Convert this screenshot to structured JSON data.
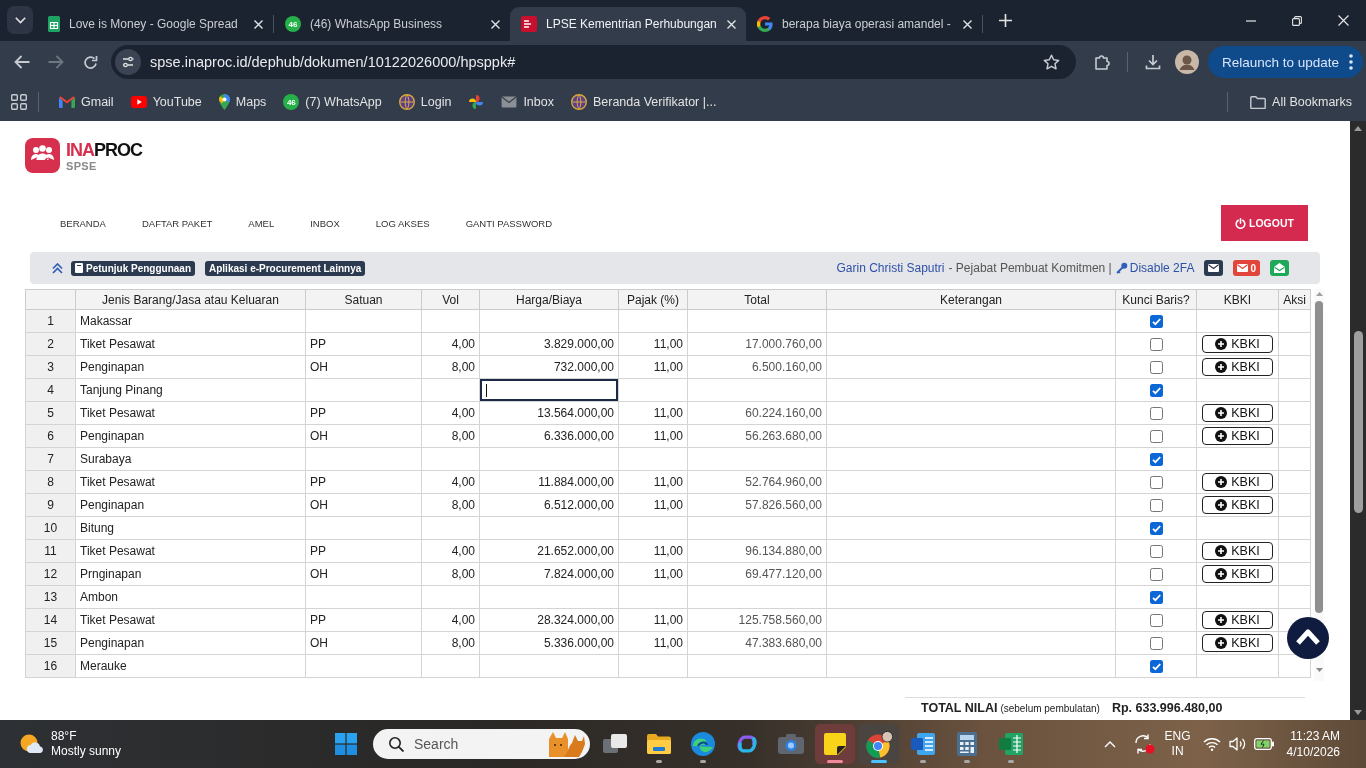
{
  "browser": {
    "tabs": [
      {
        "title": "Love is Money - Google Spread",
        "kind": "sheets",
        "selected": false
      },
      {
        "title": "(46) WhatsApp Business",
        "kind": "chat",
        "badge": "46",
        "selected": false
      },
      {
        "title": "LPSE Kementrian Perhubungan",
        "kind": "logo",
        "selected": true
      },
      {
        "title": "berapa biaya operasi amandel -",
        "kind": "search",
        "selected": false
      }
    ],
    "address": "spse.inaproc.id/dephub/dokumen/10122026000/hpsppk#",
    "relaunch": "Relaunch to update",
    "bookmarks": [
      {
        "label": "Gmail",
        "kind": "gmail"
      },
      {
        "label": "YouTube",
        "kind": "video"
      },
      {
        "label": "Maps",
        "kind": "pin"
      },
      {
        "label": "(7) WhatsApp",
        "kind": "chat",
        "badge": "46"
      },
      {
        "label": "Login",
        "kind": "globe"
      },
      {
        "kind": "photos"
      },
      {
        "label": "Inbox",
        "kind": "mail"
      },
      {
        "label": "Beranda Verifikator |...",
        "kind": "globe"
      }
    ],
    "all_bookmarks": "All Bookmarks"
  },
  "site": {
    "logo": {
      "wordmark_red": "INA",
      "wordmark_dark": "PROC",
      "subtitle": "SPSE"
    },
    "nav": [
      "BERANDA",
      "DAFTAR PAKET",
      "AMEL",
      "INBOX",
      "LOG AKSES",
      "GANTI PASSWORD"
    ],
    "logout": "LOGOUT",
    "info_bar": {
      "links": [
        {
          "label": "Petunjuk Penggunaan",
          "kind": "guide"
        },
        {
          "label": "Aplikasi e-Procurement Lainnya",
          "kind": "apps"
        }
      ],
      "user": "Garin Christi Saputri",
      "role": "- Pejabat Pembuat Komitmen |",
      "disable_2fa": "Disable 2FA",
      "unread_count": "0"
    }
  },
  "table": {
    "columns": [
      "Jenis Barang/Jasa atau Keluaran",
      "Satuan",
      "Vol",
      "Harga/Biaya",
      "Pajak (%)",
      "Total",
      "Keterangan",
      "Kunci Baris?",
      "KBKI",
      "Aksi"
    ],
    "rows": [
      {
        "no": "1",
        "item": "Makassar",
        "locked": true,
        "editing": false
      },
      {
        "no": "2",
        "item": "Tiket Pesawat",
        "unit": "PP",
        "vol": "4,00",
        "price": "3.829.000,00",
        "tax": "11,00",
        "total": "17.000.760,00",
        "locked": false,
        "editing": false,
        "kbki": "KBKI"
      },
      {
        "no": "3",
        "item": "Penginapan",
        "unit": "OH",
        "vol": "8,00",
        "price": "732.000,00",
        "tax": "11,00",
        "total": "6.500.160,00",
        "locked": false,
        "editing": false,
        "kbki": "KBKI"
      },
      {
        "no": "4",
        "item": "Tanjung Pinang",
        "locked": true,
        "editing": true
      },
      {
        "no": "5",
        "item": "Tiket Pesawat",
        "unit": "PP",
        "vol": "4,00",
        "price": "13.564.000,00",
        "tax": "11,00",
        "total": "60.224.160,00",
        "locked": false,
        "editing": false,
        "kbki": "KBKI"
      },
      {
        "no": "6",
        "item": "Penginapan",
        "unit": "OH",
        "vol": "8,00",
        "price": "6.336.000,00",
        "tax": "11,00",
        "total": "56.263.680,00",
        "locked": false,
        "editing": false,
        "kbki": "KBKI"
      },
      {
        "no": "7",
        "item": "Surabaya",
        "locked": true,
        "editing": false
      },
      {
        "no": "8",
        "item": "Tiket Pesawat",
        "unit": "PP",
        "vol": "4,00",
        "price": "11.884.000,00",
        "tax": "11,00",
        "total": "52.764.960,00",
        "locked": false,
        "editing": false,
        "kbki": "KBKI"
      },
      {
        "no": "9",
        "item": "Penginapan",
        "unit": "OH",
        "vol": "8,00",
        "price": "6.512.000,00",
        "tax": "11,00",
        "total": "57.826.560,00",
        "locked": false,
        "editing": false,
        "kbki": "KBKI"
      },
      {
        "no": "10",
        "item": "Bitung",
        "locked": true,
        "editing": false
      },
      {
        "no": "11",
        "item": "Tiket Pesawat",
        "unit": "PP",
        "vol": "4,00",
        "price": "21.652.000,00",
        "tax": "11,00",
        "total": "96.134.880,00",
        "locked": false,
        "editing": false,
        "kbki": "KBKI"
      },
      {
        "no": "12",
        "item": "Prnginapan",
        "unit": "OH",
        "vol": "8,00",
        "price": "7.824.000,00",
        "tax": "11,00",
        "total": "69.477.120,00",
        "locked": false,
        "editing": false,
        "kbki": "KBKI"
      },
      {
        "no": "13",
        "item": "Ambon",
        "locked": true,
        "editing": false
      },
      {
        "no": "14",
        "item": "Tiket Pesawat",
        "unit": "PP",
        "vol": "4,00",
        "price": "28.324.000,00",
        "tax": "11,00",
        "total": "125.758.560,00",
        "locked": false,
        "editing": false,
        "kbki": "KBKI"
      },
      {
        "no": "15",
        "item": "Penginapan",
        "unit": "OH",
        "vol": "8,00",
        "price": "5.336.000,00",
        "tax": "11,00",
        "total": "47.383.680,00",
        "locked": false,
        "editing": false,
        "kbki": "KBKI"
      },
      {
        "no": "16",
        "item": "Merauke",
        "locked": true,
        "editing": false
      }
    ]
  },
  "total": {
    "label": "TOTAL NILAI",
    "note": "(sebelum pembulatan)",
    "value": "Rp. 633.996.480,00"
  },
  "taskbar": {
    "weather": {
      "temperature": "88°F",
      "condition": "Mostly sunny"
    },
    "search": {
      "placeholder": "Search"
    },
    "apps": [
      {
        "kind": "task-view",
        "running": false,
        "focused": false,
        "flashing": false
      },
      {
        "kind": "explorer",
        "running": true,
        "focused": false,
        "flashing": false
      },
      {
        "kind": "edge",
        "running": true,
        "focused": false,
        "flashing": false
      },
      {
        "kind": "copilot",
        "running": false,
        "focused": false,
        "flashing": false
      },
      {
        "kind": "camera",
        "running": false,
        "focused": false,
        "flashing": false
      },
      {
        "kind": "notes",
        "running": true,
        "focused": false,
        "flashing": true
      },
      {
        "kind": "chrome",
        "running": true,
        "focused": true,
        "flashing": false
      },
      {
        "kind": "word",
        "running": true,
        "focused": false,
        "flashing": false
      },
      {
        "kind": "calculator",
        "running": true,
        "focused": false,
        "flashing": false
      },
      {
        "kind": "excel",
        "running": true,
        "focused": false,
        "flashing": false
      }
    ],
    "tray": {
      "language": "ENG",
      "region": "IN",
      "time": "11:23 AM",
      "date": "4/10/2026"
    }
  }
}
